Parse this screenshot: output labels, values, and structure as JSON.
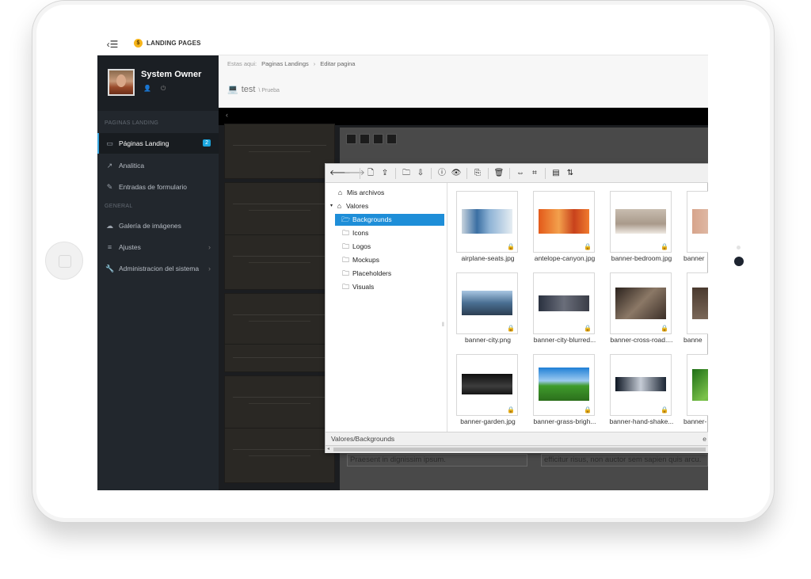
{
  "app": {
    "brand": "LANDING PAGES"
  },
  "profile": {
    "name": "System Owner"
  },
  "sidebar": {
    "section1": "PAGINAS LANDING",
    "section2": "GENERAL",
    "items": [
      {
        "label": "Páginas Landing",
        "icon": "laptop-icon",
        "badge": "2"
      },
      {
        "label": "Analitica",
        "icon": "line-chart-icon"
      },
      {
        "label": "Entradas de formulario",
        "icon": "edit-icon"
      },
      {
        "label": "Galería de imágenes",
        "icon": "cloud-icon"
      },
      {
        "label": "Ajustes",
        "icon": "sliders-icon"
      },
      {
        "label": "Administracion del sistema",
        "icon": "wrench-icon"
      }
    ]
  },
  "breadcrumb": {
    "prefix": "Estas aqui:",
    "items": [
      "Paginas Landings",
      "Editar pagina"
    ]
  },
  "page": {
    "title": "test",
    "subtitle": "\\ Prueba"
  },
  "editor": {
    "text_left": "Praesent in dignissim ipsum.",
    "text_right": "efficitur risus, non auctor sem sapien quis arcu."
  },
  "filemanager": {
    "tree": [
      "Mis archivos",
      "Valores",
      "Backgrounds",
      "Icons",
      "Logos",
      "Mockups",
      "Placeholders",
      "Visuals"
    ],
    "files": [
      "airplane-seats.jpg",
      "antelope-canyon.jpg",
      "banner-bedroom.jpg",
      "banner",
      "banner-city.png",
      "banner-city-blurred...",
      "banner-cross-road....",
      "banne",
      "banner-garden.jpg",
      "banner-grass-brigh...",
      "banner-hand-shake...",
      "banner-"
    ],
    "status": "Valores/Backgrounds",
    "status_right": "e"
  },
  "colors": {
    "accent": "#1e8ed8",
    "sidebar": "#22272d",
    "badge": "#1aa5de"
  }
}
